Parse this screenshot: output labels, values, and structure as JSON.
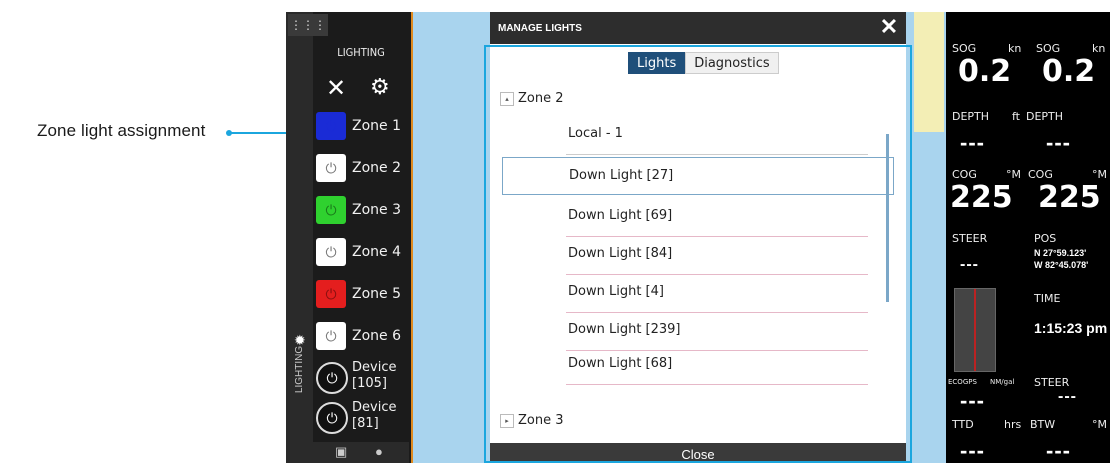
{
  "callout": {
    "label": "Zone light assignment"
  },
  "lighting_panel": {
    "title": "LIGHTING",
    "close_icon": "close-icon",
    "settings_icon": "gear-icon",
    "vertical_label": "LIGHTING",
    "zones": [
      {
        "label": "Zone 1",
        "color": "#1a2bd6"
      },
      {
        "label": "Zone 2",
        "color": "#ffffff"
      },
      {
        "label": "Zone 3",
        "color": "#2fd12f"
      },
      {
        "label": "Zone 4",
        "color": "#ffffff"
      },
      {
        "label": "Zone 5",
        "color": "#e41e1e"
      },
      {
        "label": "Zone 6",
        "color": "#ffffff"
      }
    ],
    "devices": [
      {
        "label": "Device\n[105]"
      },
      {
        "label": "Device\n[81]"
      }
    ]
  },
  "dialog": {
    "title": "MANAGE LIGHTS",
    "close_glyph": "✕",
    "tabs": [
      {
        "label": "Lights",
        "active": true
      },
      {
        "label": "Diagnostics",
        "active": false
      }
    ],
    "groups": [
      {
        "label": "Zone 2",
        "expanded": true,
        "items": [
          "Local - 1",
          "Down Light [27]",
          "Down Light [69]",
          "Down Light [84]",
          "Down Light [4]",
          "Down Light [239]",
          "Down Light [68]"
        ],
        "selected": "Down Light [27]"
      },
      {
        "label": "Zone 3",
        "expanded": false
      }
    ],
    "footer_button": "Close"
  },
  "instruments": {
    "sog1_label": "SOG",
    "sog1_unit": "kn",
    "sog2_label": "SOG",
    "sog2_unit": "kn",
    "sog1_value": "0.2",
    "sog2_value": "0.2",
    "depth1_label": "DEPTH",
    "depth1_unit": "ft",
    "depth2_label": "DEPTH",
    "depth1_value": "---",
    "depth2_value": "---",
    "cog1_label": "COG",
    "cog1_unit": "°M",
    "cog2_label": "COG",
    "cog2_unit": "°M",
    "cog1_value": "225",
    "cog2_value": "225",
    "steer_label": "STEER",
    "pos_label": "POS",
    "steer_value": "---",
    "pos_lat": "N  27°59.123'",
    "pos_lon": "W  82°45.078'",
    "time_label": "TIME",
    "time_value": "1:15:23 pm",
    "eco_label": "ECOGPS",
    "eco_unit": "NM/gal",
    "steer2_label": "STEER",
    "steer2_value": "---",
    "eco_value": "---",
    "ttd_label": "TTD",
    "ttd_unit": "hrs",
    "btw_label": "BTW",
    "btw_unit": "°M",
    "ttd_value": "---",
    "btw_value": "---"
  }
}
